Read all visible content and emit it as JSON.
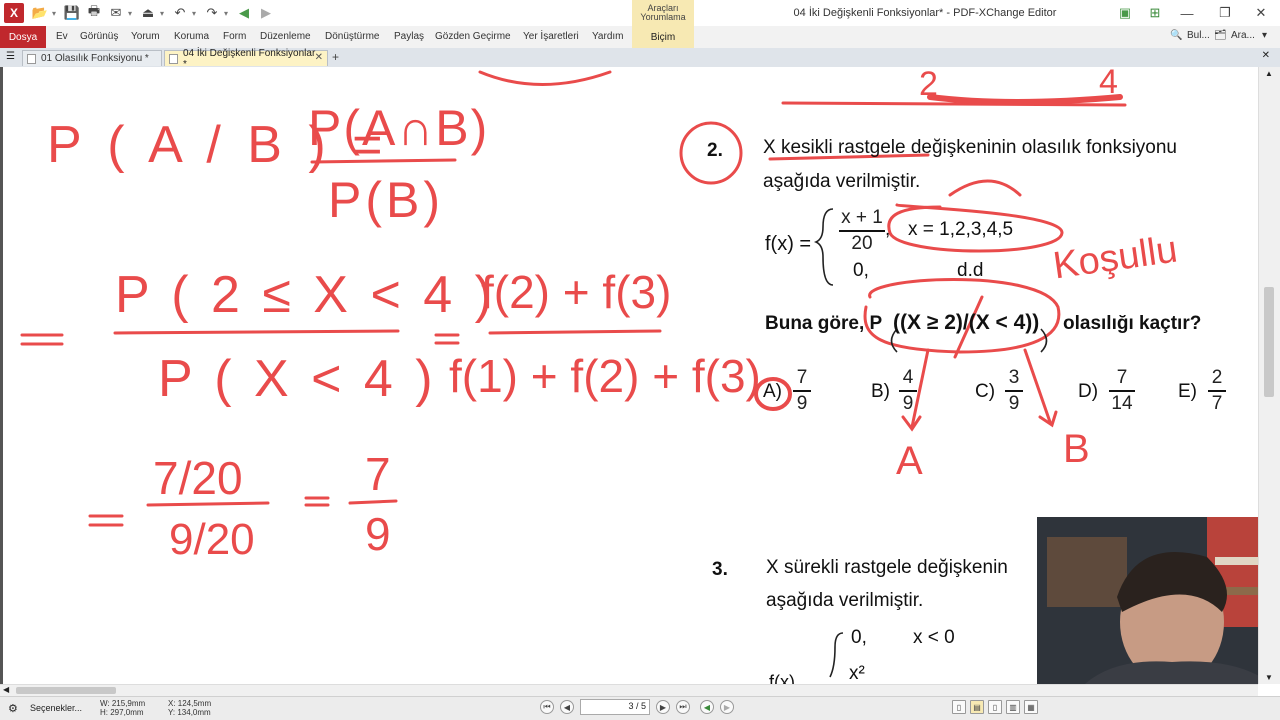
{
  "titlebar": {
    "window_title": "04 İki Değişkenli Fonksiyonlar* - PDF-XChange Editor",
    "context_group": "Araçları Yorumlama",
    "app_logo": "X"
  },
  "quick_access_icons": [
    "open-icon",
    "save-icon",
    "print-icon",
    "email-icon",
    "scan-icon",
    "undo-icon",
    "redo-icon",
    "back-icon",
    "forward-icon"
  ],
  "menu": {
    "file": "Dosya",
    "items": [
      "Ev",
      "Görünüş",
      "Yorum",
      "Koruma",
      "Form",
      "Düzenleme",
      "Dönüştürme",
      "Paylaş",
      "Gözden Geçirme",
      "Yer İşaretleri",
      "Yardım"
    ],
    "context_tab": "Biçim",
    "right_tools": [
      "Bul...",
      "Ara..."
    ]
  },
  "tabs": [
    {
      "label": "01 Olasılık Fonksiyonu *"
    },
    {
      "label": "04 İki Değişkenli Fonksiyonlar *"
    }
  ],
  "question2": {
    "number": "2.",
    "text_line1": "X kesikli rastgele değişkeninin olasılık fonksiyonu",
    "text_line2": "aşağıda verilmiştir.",
    "fx_label": "f(x) =",
    "numerator": "x + 1",
    "denominator": "20",
    "case1_condition": "x = 1,2,3,4,5",
    "case2_value": "0,",
    "case2_condition": "d.d",
    "prompt_start": "Buna göre, P",
    "prompt_expr": "((X ≥ 2)/(X < 4))",
    "prompt_end": "olasılığı kaçtır?",
    "options": [
      {
        "label": "A)",
        "num": "7",
        "den": "9"
      },
      {
        "label": "B)",
        "num": "4",
        "den": "9"
      },
      {
        "label": "C)",
        "num": "3",
        "den": "9"
      },
      {
        "label": "D)",
        "num": "7",
        "den": "14"
      },
      {
        "label": "E)",
        "num": "2",
        "den": "7"
      }
    ]
  },
  "question3": {
    "number": "3.",
    "text_line1": "X sürekli rastgele değişkenin",
    "text_line2": "aşağıda verilmiştir.",
    "case1_value": "0,",
    "case1_condition": "x < 0",
    "case2_value": "x²",
    "fx_partial": "f(x)"
  },
  "handwriting": {
    "formula_lhs": "P ( A / B ) =",
    "formula_num": "P(A∩B)",
    "formula_den": "P(B)",
    "eq_sign": "=",
    "step1_num": "P ( 2 ≤ X < 4 )",
    "step1_den": "P ( X < 4 )",
    "step2_num": "f(2) + f(3)",
    "step2_den": "f(1) + f(2) + f(3)",
    "step3_num": "7/20",
    "step3_den": "9/20",
    "result": "7",
    "result_den": "9",
    "label_conditional": "Koşullu",
    "label_a": "A",
    "label_b": "B",
    "numbers_top_left": "2",
    "numbers_top_right": "4"
  },
  "statusbar": {
    "options": "Seçenekler...",
    "width": "W: 215,9mm",
    "height": "H: 297,0mm",
    "x": "X: 124,5mm",
    "y": "Y: 134,0mm",
    "page": "3 / 5"
  },
  "colors": {
    "ink": "#e94b4b",
    "brand": "#c0282d",
    "context": "#f7e9b3"
  }
}
